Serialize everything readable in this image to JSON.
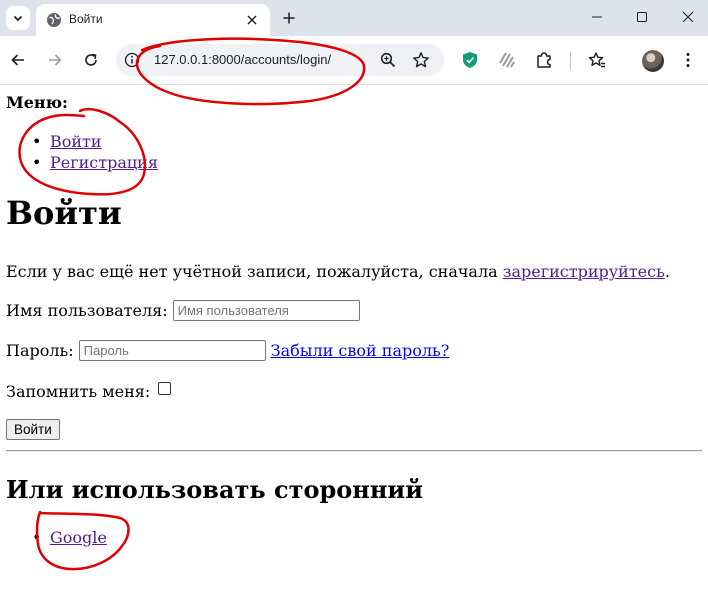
{
  "browser": {
    "tab_title": "Войти",
    "url": "127.0.0.1:8000/accounts/login/",
    "icons": {
      "tab_search": "chevron-down-icon",
      "favicon": "globe-icon",
      "tab_close": "close-icon",
      "new_tab": "plus-icon",
      "minimize": "minimize-icon",
      "maximize": "maximize-icon",
      "window_close": "close-icon",
      "back": "arrow-left-icon",
      "forward": "arrow-right-icon",
      "reload": "reload-icon",
      "site_info": "info-icon",
      "zoom": "zoom-icon",
      "bookmark": "star-icon",
      "extension_1": "shield-icon",
      "extension_2": "stripes-icon",
      "extensions": "puzzle-icon",
      "bookmarks_panel": "star-list-icon",
      "menu": "more-vert-icon"
    }
  },
  "page": {
    "menu_label": "Меню:",
    "menu_items": [
      {
        "label": "Войти"
      },
      {
        "label": "Регистрация"
      }
    ],
    "title": "Войти",
    "intro_text": "Если у вас ещё нет учётной записи, пожалуйста, сначала",
    "intro_link": "зарегистрируйтесь",
    "intro_end": ".",
    "username_label": "Имя пользователя:",
    "username_placeholder": "Имя пользователя",
    "username_value": "",
    "password_label": "Пароль:",
    "password_placeholder": "Пароль",
    "password_value": "",
    "forgot_link": "Забыли свой пароль?",
    "remember_label": "Запомнить меня:",
    "remember_checked": false,
    "submit_label": "Войти",
    "alt_heading": "Или использовать сторонний",
    "providers": [
      {
        "label": "Google"
      }
    ]
  },
  "colors": {
    "visited_link": "#551a8b",
    "link": "#0000ee",
    "annotation": "#e00000",
    "tabstrip": "#dee3eb"
  }
}
